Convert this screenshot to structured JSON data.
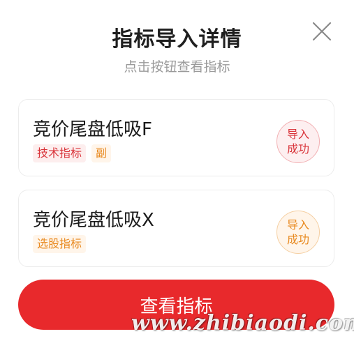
{
  "dialog": {
    "title": "指标导入详情",
    "subtitle": "点击按钮查看指标",
    "close_icon": "close-icon"
  },
  "items": [
    {
      "name": "竞价尾盘低吸F",
      "tags": [
        "技术指标",
        "副"
      ],
      "status_line1": "导入",
      "status_line2": "成功",
      "status_color": "#d9343a"
    },
    {
      "name": "竞价尾盘低吸X",
      "tags": [
        "选股指标"
      ],
      "status_line1": "导入",
      "status_line2": "成功",
      "status_color": "#e8891f"
    }
  ],
  "primary_button": {
    "label": "查看指标",
    "color": "#e8292c"
  },
  "watermark": "www.zhibiaodi.com"
}
